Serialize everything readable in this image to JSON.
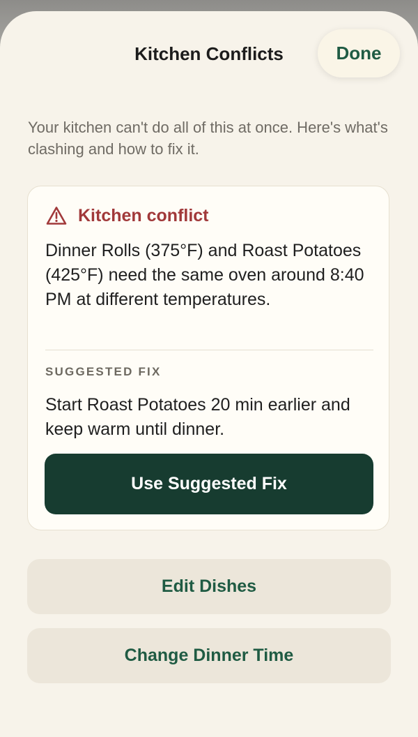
{
  "header": {
    "title": "Kitchen Conflicts",
    "done_label": "Done"
  },
  "intro": "Your kitchen can't do all of this at once. Here's what's clashing and how to fix it.",
  "conflict_card": {
    "icon": "warning-triangle-icon",
    "title": "Kitchen conflict",
    "description": "Dinner Rolls (375°F) and Roast Potatoes (425°F) need the same oven around 8:40 PM at different temperatures.",
    "fix_label": "SUGGESTED FIX",
    "fix_description": "Start Roast Potatoes 20 min earlier and keep warm until dinner.",
    "fix_button_label": "Use Suggested Fix"
  },
  "actions": {
    "edit_dishes_label": "Edit Dishes",
    "change_time_label": "Change Dinner Time"
  },
  "colors": {
    "accent_green": "#1f5b43",
    "primary_button": "#173c30",
    "conflict_red": "#a1393a",
    "sheet_background": "#f7f3ea"
  }
}
